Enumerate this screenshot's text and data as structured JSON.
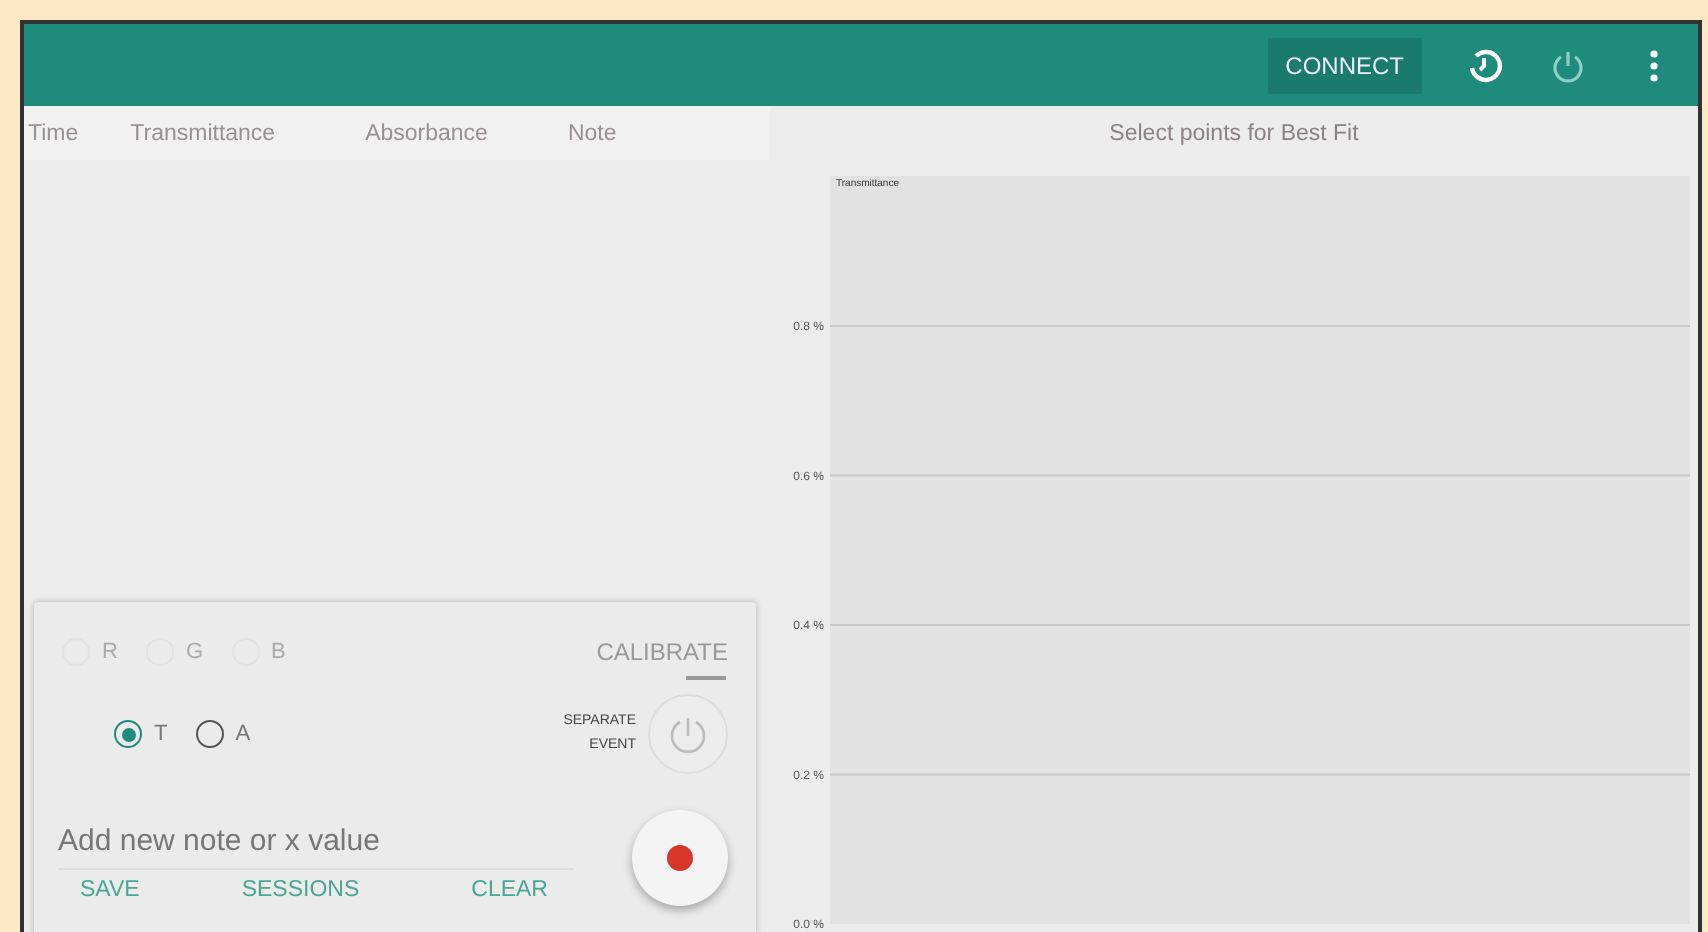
{
  "app_bar": {
    "connect_label": "CONNECT"
  },
  "table": {
    "columns": [
      "Time",
      "Transmittance",
      "Absorbance",
      "Note"
    ]
  },
  "controls": {
    "color_channels": [
      {
        "label": "R",
        "selected": false,
        "disabled": true
      },
      {
        "label": "G",
        "selected": false,
        "disabled": true
      },
      {
        "label": "B",
        "selected": false,
        "disabled": true
      }
    ],
    "modes": [
      {
        "label": "T",
        "selected": true
      },
      {
        "label": "A",
        "selected": false
      }
    ],
    "calibrate_label": "CALIBRATE",
    "separate_event_label": "SEPARATE EVENT",
    "note_field": {
      "placeholder": "Add new note or x value"
    },
    "buttons": [
      "SAVE",
      "SESSIONS",
      "CLEAR"
    ]
  },
  "chart": {
    "title": "Select points for Best Fit",
    "y_axis_title": "Transmittance",
    "y_axis_labels": [
      "0.8 %",
      "0.6 %",
      "0.4 %",
      "0.2 %",
      "0.0 %"
    ]
  }
}
